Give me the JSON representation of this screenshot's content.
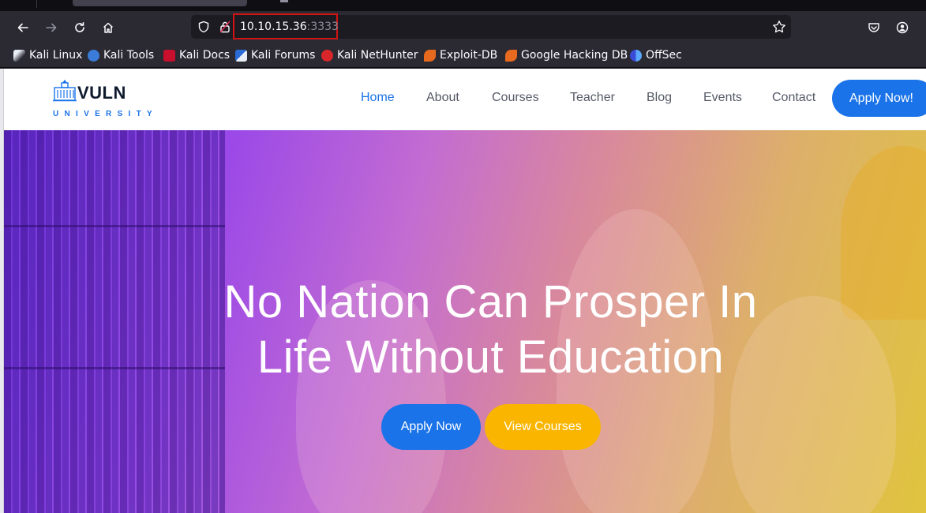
{
  "browser": {
    "url_host": "10.10.15.36",
    "url_port": ":3333",
    "bookmarks": [
      {
        "label": "Kali Linux",
        "icon": "kali-dragon-icon"
      },
      {
        "label": "Kali Tools",
        "icon": "kali-tools-icon"
      },
      {
        "label": "Kali Docs",
        "icon": "kali-docs-icon"
      },
      {
        "label": "Kali Forums",
        "icon": "kali-forums-icon"
      },
      {
        "label": "Kali NetHunter",
        "icon": "nethunter-icon"
      },
      {
        "label": "Exploit-DB",
        "icon": "exploit-db-icon"
      },
      {
        "label": "Google Hacking DB",
        "icon": "ghdb-icon"
      },
      {
        "label": "OffSec",
        "icon": "offsec-icon"
      }
    ]
  },
  "site": {
    "logo_main": "VULN",
    "logo_sub": "UNIVERSITY",
    "nav": [
      "Home",
      "About",
      "Courses",
      "Teacher",
      "Blog",
      "Events",
      "Contact"
    ],
    "apply_top": "Apply Now!"
  },
  "hero": {
    "title_line1": "No Nation Can Prosper In",
    "title_line2": "Life Without Education",
    "btn_primary": "Apply Now",
    "btn_secondary": "View Courses"
  },
  "colors": {
    "accent": "#1a73e8",
    "warning": "#f9b500",
    "url_highlight": "#d01414"
  }
}
